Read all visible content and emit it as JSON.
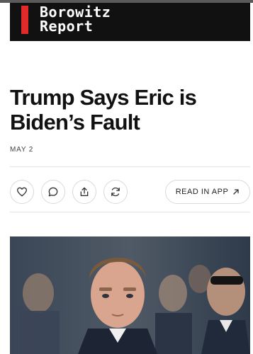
{
  "masthead": {
    "title_line1": "Borowitz",
    "title_line2": "Report"
  },
  "article": {
    "headline_line1": "Trump Says Eric is",
    "headline_line2": "Biden’s Fault",
    "date": "MAY 2"
  },
  "actions": {
    "read_in_app_label": "READ IN APP",
    "icons": [
      "heart-icon",
      "comment-icon",
      "share-icon",
      "restack-icon",
      "arrow-up-right-icon"
    ]
  },
  "colors": {
    "masthead_bg": "#111111",
    "masthead_accent": "#e12b2b"
  }
}
